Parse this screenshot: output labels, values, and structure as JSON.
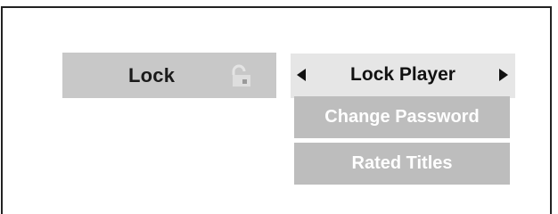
{
  "menu": {
    "category": {
      "label": "Lock",
      "icon": "padlock-icon"
    },
    "selected_option": {
      "label": "Lock Player",
      "left_arrow_icon": "triangle-left-icon",
      "right_arrow_icon": "triangle-right-icon"
    },
    "options": [
      {
        "label": "Change Password"
      },
      {
        "label": "Rated Titles"
      }
    ]
  },
  "colors": {
    "category_bg": "#c8c8c8",
    "selected_bg": "#e6e6e6",
    "option_bg": "#bdbdbd",
    "option_text": "#ffffff",
    "frame_border": "#222222"
  }
}
